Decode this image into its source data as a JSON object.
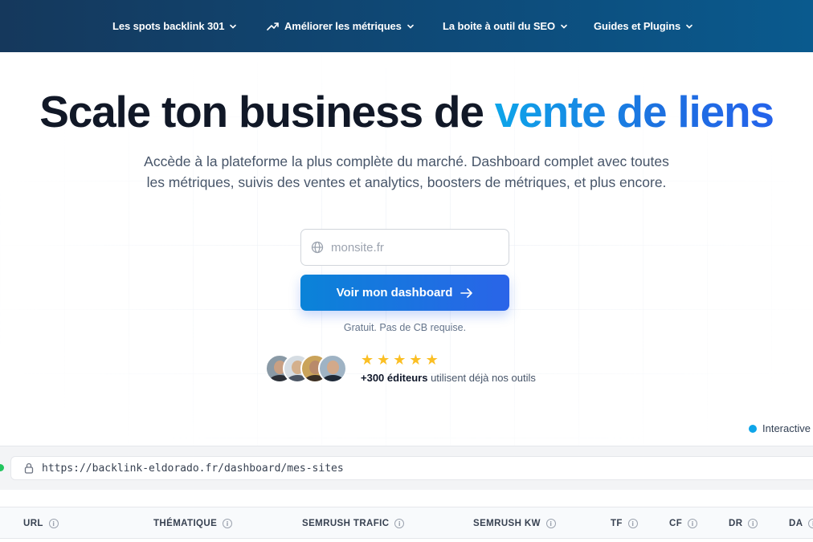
{
  "nav": {
    "items": [
      {
        "label": "Les spots backlink 301"
      },
      {
        "label": "Améliorer les métriques"
      },
      {
        "label": "La boite à outil du SEO"
      },
      {
        "label": "Guides et Plugins"
      }
    ]
  },
  "hero": {
    "title_main": "Scale ton business de ",
    "title_accent": "vente de liens",
    "subtitle_line1": "Accède à la plateforme la plus complète du marché. Dashboard complet avec toutes",
    "subtitle_line2": "les métriques, suivis des ventes et analytics, boosters de métriques, et plus encore."
  },
  "signup": {
    "input_placeholder": "monsite.fr",
    "input_value": "",
    "cta_label": "Voir mon dashboard",
    "note": "Gratuit. Pas de CB requise."
  },
  "social_proof": {
    "stars": 5,
    "count_bold": "+300 éditeurs",
    "text": " utilisent déjà nos outils"
  },
  "interactive_label": "Interactive",
  "browser": {
    "url": "https://backlink-eldorado.fr/dashboard/mes-sites"
  },
  "table": {
    "columns": [
      "URL",
      "THÉMATIQUE",
      "SEMRUSH TRAFIC",
      "SEMRUSH KW",
      "TF",
      "CF",
      "DR",
      "DA"
    ]
  },
  "colors": {
    "nav_bg": "#15385c",
    "accent": "#1d70e0",
    "cta": "#2a64e8",
    "star": "#fbbf24",
    "status_dot": "#0ea5e9"
  }
}
